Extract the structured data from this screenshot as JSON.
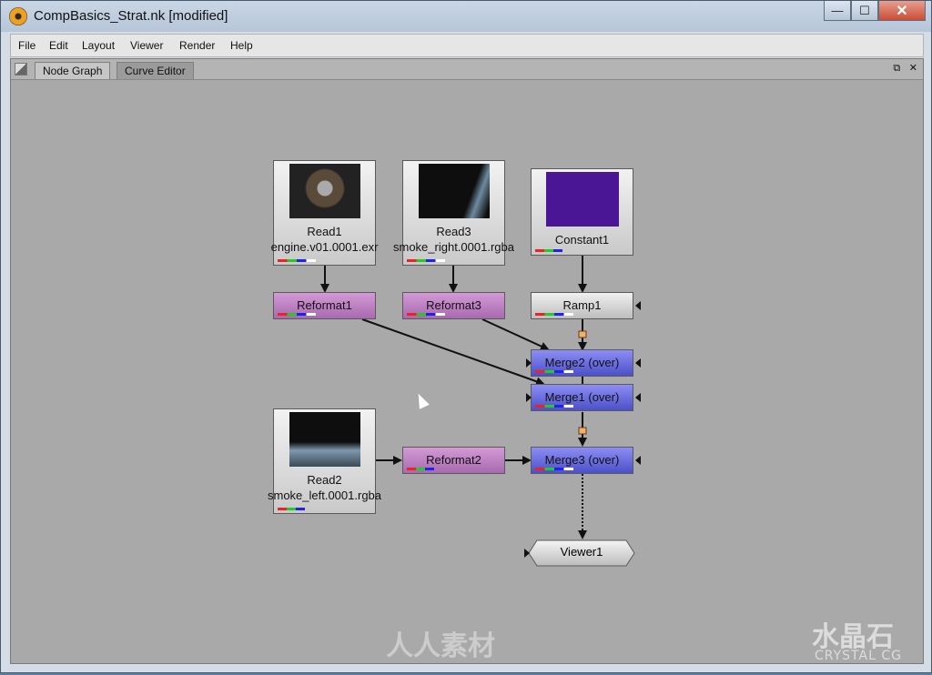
{
  "window": {
    "title": "CompBasics_Strat.nk [modified]",
    "minimize_label": "—",
    "maximize_label": "☐",
    "close_label": "✕"
  },
  "menu": {
    "items": [
      "File",
      "Edit",
      "Layout",
      "Viewer",
      "Render",
      "Help"
    ]
  },
  "panel": {
    "tabs": [
      {
        "label": "Node Graph",
        "active": true
      },
      {
        "label": "Curve Editor",
        "active": false
      }
    ],
    "float_label": "⧉",
    "close_label": "✕"
  },
  "nodes": {
    "read1": {
      "name": "Read1",
      "file": "engine.v01.0001.exr"
    },
    "read3": {
      "name": "Read3",
      "file": "smoke_right.0001.rgba"
    },
    "constant1": {
      "name": "Constant1",
      "color": "#4b1696"
    },
    "reformat1": {
      "name": "Reformat1"
    },
    "reformat3": {
      "name": "Reformat3"
    },
    "ramp1": {
      "name": "Ramp1"
    },
    "merge2": {
      "name": "Merge2 (over)"
    },
    "merge1": {
      "name": "Merge1 (over)"
    },
    "read2": {
      "name": "Read2",
      "file": "smoke_left.0001.rgba"
    },
    "reformat2": {
      "name": "Reformat2"
    },
    "merge3": {
      "name": "Merge3 (over)"
    },
    "viewer1": {
      "name": "Viewer1"
    }
  },
  "watermark": {
    "center_text": "人人素材",
    "brand_cn": "水晶石",
    "brand_en": "CRYSTAL CG"
  }
}
